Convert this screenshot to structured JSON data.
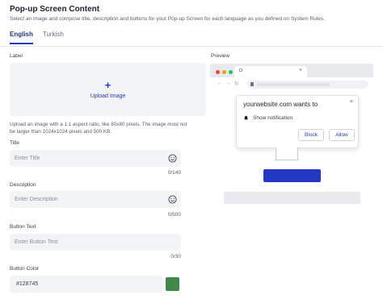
{
  "header": {
    "title": "Pop-up Screen Content",
    "subtitle": "Select an image and compose title, description and buttons for your Pop-up Screen for each language as you defined on System Rules."
  },
  "tabs": [
    {
      "label": "English",
      "active": true
    },
    {
      "label": "Turkish",
      "active": false
    }
  ],
  "label_section": {
    "label": "Label",
    "upload_label": "Upload Image",
    "hint": "Upload an image with a 1:1 aspect ratio, like 80x80 pixels. The image must not be larger than 1024x1024 pixels and 500 KB."
  },
  "title_field": {
    "label": "Title",
    "placeholder": "Enter Title",
    "counter": "0/140"
  },
  "description_field": {
    "label": "Description",
    "placeholder": "Enter Description",
    "counter": "0/500"
  },
  "button_text_field": {
    "label": "Button Text",
    "placeholder": "Enter Button Text",
    "counter": "0/30"
  },
  "button_color_field": {
    "label": "Button Color",
    "value": "#128745"
  },
  "preview": {
    "label": "Preview",
    "popup_title": "yourwebsite.com wants to",
    "notification_text": "Show notification",
    "block_label": "Block",
    "allow_label": "Allow",
    "close_glyph": "×"
  },
  "colors": {
    "accent": "#2339c4",
    "swatch": "#3f8a4a",
    "dot_red": "#ef4444",
    "dot_yellow": "#f59e0b",
    "dot_green": "#22c55e"
  }
}
